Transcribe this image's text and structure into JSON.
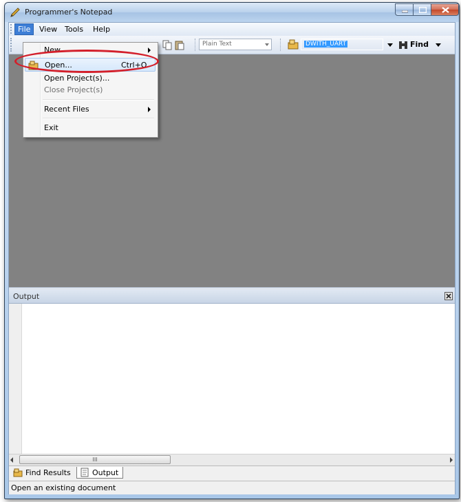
{
  "window": {
    "title": "Programmer's Notepad"
  },
  "menubar": {
    "items": [
      "File",
      "View",
      "Tools",
      "Help"
    ]
  },
  "toolbar": {
    "scheme_combo": "Plain Text",
    "project_combo": "DWITH_UART",
    "find_label": "Find"
  },
  "file_menu": {
    "new": "New",
    "open": "Open...",
    "open_shortcut": "Ctrl+O",
    "open_project": "Open Project(s)...",
    "close_project": "Close Project(s)",
    "recent_files": "Recent Files",
    "exit": "Exit"
  },
  "output": {
    "title": "Output",
    "scroll_thumb": "III"
  },
  "tabs": [
    "Find Results",
    "Output"
  ],
  "status": {
    "text": "Open an existing document"
  },
  "colors": {
    "highlight_ellipse": "#d31f2a",
    "menu_active": "#3d7ed6",
    "editor_bg": "#828282"
  }
}
